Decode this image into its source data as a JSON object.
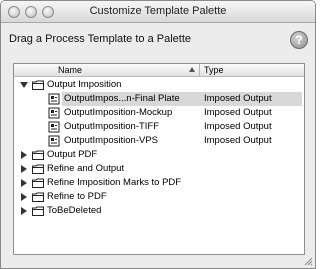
{
  "window": {
    "title": "Customize Template Palette"
  },
  "instruction": "Drag a Process Template to a Palette",
  "help": {
    "label": "?"
  },
  "table": {
    "columns": {
      "name": "Name",
      "type": "Type"
    },
    "rows": [
      {
        "label": "Output Imposition",
        "kind": "folder",
        "expanded": true,
        "type": ""
      },
      {
        "label": "OutputImpos...n-Final Plate",
        "kind": "template",
        "type": "Imposed Output",
        "selected": true
      },
      {
        "label": "OutputImposition-Mockup",
        "kind": "template",
        "type": "Imposed Output"
      },
      {
        "label": "OutputImposition-TIFF",
        "kind": "template",
        "type": "Imposed Output"
      },
      {
        "label": "OutputImposition-VPS",
        "kind": "template",
        "type": "Imposed Output"
      },
      {
        "label": "Output PDF",
        "kind": "folder",
        "expanded": false,
        "type": ""
      },
      {
        "label": "Refine and Output",
        "kind": "folder",
        "expanded": false,
        "type": ""
      },
      {
        "label": "Refine Imposition Marks to PDF",
        "kind": "folder",
        "expanded": false,
        "type": ""
      },
      {
        "label": "Refine to PDF",
        "kind": "folder",
        "expanded": false,
        "type": ""
      },
      {
        "label": "ToBeDeleted",
        "kind": "folder",
        "expanded": false,
        "type": ""
      }
    ]
  }
}
